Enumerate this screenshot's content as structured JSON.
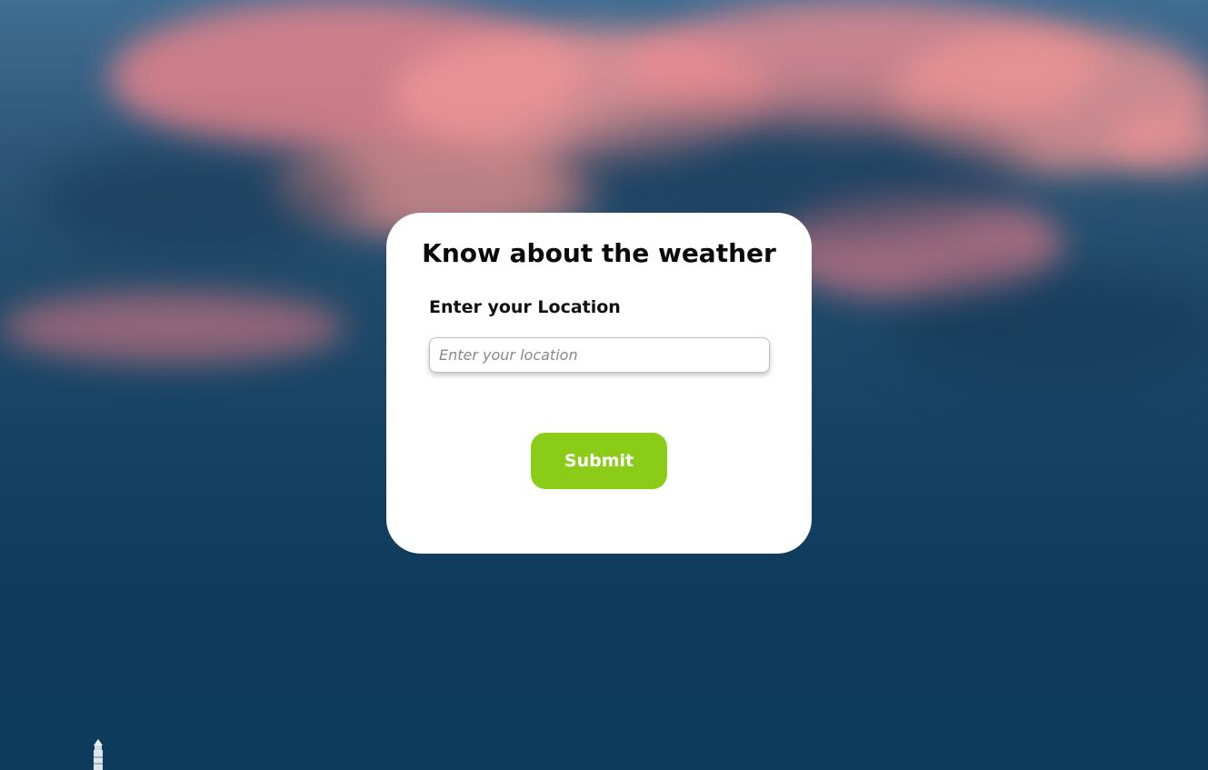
{
  "card": {
    "title": "Know about the weather",
    "location_label": "Enter your Location",
    "location_input": {
      "value": "",
      "placeholder": "Enter your location"
    },
    "submit_label": "Submit"
  },
  "colors": {
    "card_background": "#ffffff",
    "submit_button": "#8bcc19",
    "sky_dark": "#0f3a5b",
    "cloud_pink": "#e8848c"
  },
  "icons": {
    "background_decoration": "lighthouse-icon"
  }
}
